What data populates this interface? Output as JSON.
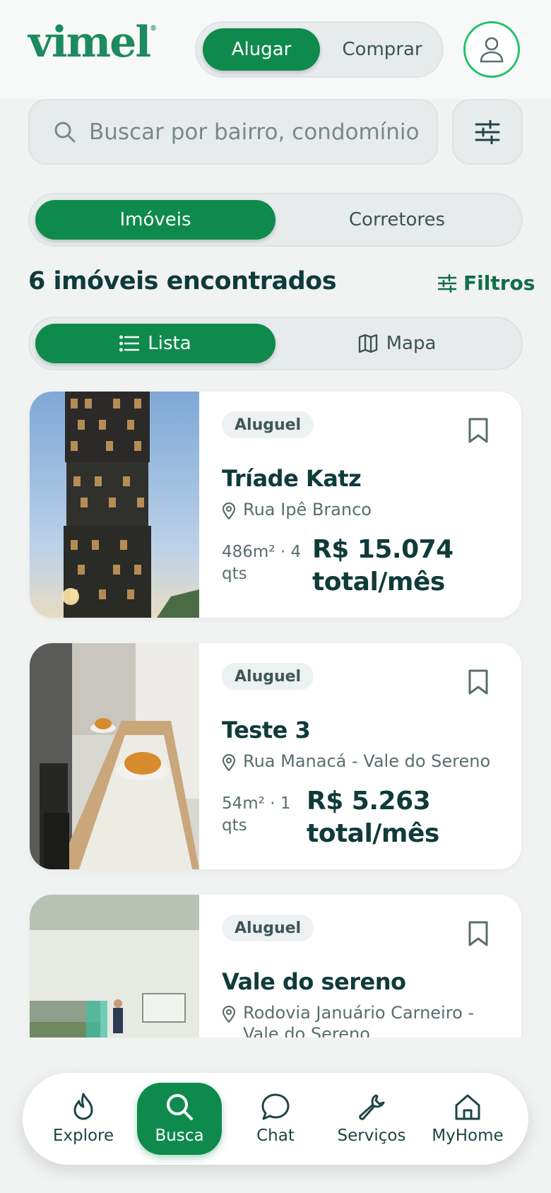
{
  "header": {
    "logo": "vimel",
    "logo_mark": "®",
    "mode_active": "Alugar",
    "mode_inactive": "Comprar",
    "profile_icon": "user-icon"
  },
  "search": {
    "placeholder": "Buscar por bairro, condomínio",
    "icon": "search-icon",
    "filter_icon": "sliders-icon"
  },
  "segment": {
    "active": "Imóveis",
    "inactive": "Corretores"
  },
  "results": {
    "count_text": "6 imóveis encontrados",
    "filters_label": "Filtros"
  },
  "view": {
    "list_label": "Lista",
    "map_label": "Mapa"
  },
  "listings": [
    {
      "badge": "Aluguel",
      "title": "Tríade Katz",
      "address": "Rua Ipê Branco",
      "meta": "486m² · 4 qts",
      "price": "R$ 15.074",
      "price_suffix": "total/mês"
    },
    {
      "badge": "Aluguel",
      "title": "Teste 3",
      "address": "Rua Manacá - Vale do Sereno",
      "meta": "54m² · 1 qts",
      "price": "R$ 5.263",
      "price_suffix": "total/mês"
    },
    {
      "badge": "Aluguel",
      "title": "Vale do sereno",
      "address": "Rodovia Januário Carneiro - Vale do Sereno",
      "meta": "",
      "price": "",
      "price_suffix": ""
    }
  ],
  "nav": [
    {
      "label": "Explore",
      "icon": "flame-icon"
    },
    {
      "label": "Busca",
      "icon": "search-icon",
      "active": true
    },
    {
      "label": "Chat",
      "icon": "chat-icon"
    },
    {
      "label": "Serviços",
      "icon": "wrench-icon"
    },
    {
      "label": "MyHome",
      "icon": "home-icon"
    }
  ],
  "colors": {
    "brand": "#1d8a61",
    "accent": "#0f8a4d",
    "text": "#0f3b3a",
    "avatar_ring": "#22c26a"
  }
}
